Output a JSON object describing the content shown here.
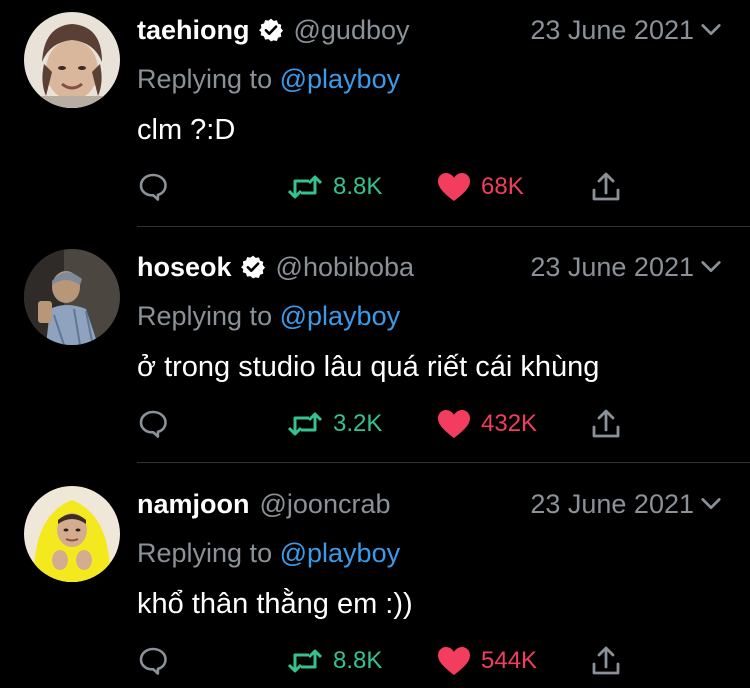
{
  "colors": {
    "background": "#000000",
    "primary_text": "#ffffff",
    "secondary_text": "#8b9198",
    "link": "#3a9bea",
    "retweet": "#35c28f",
    "like": "#f23d5e",
    "divider": "#2f3336"
  },
  "tweets": [
    {
      "display_name": "taehiong",
      "verified": true,
      "handle": "@gudboy",
      "date": "23 June 2021",
      "reply_prefix": "Replying to",
      "reply_to": "@playboy",
      "text": "clm ?:D",
      "retweets": "8.8K",
      "likes": "68K",
      "liked": true
    },
    {
      "display_name": "hoseok",
      "verified": true,
      "handle": "@hobiboba",
      "date": "23 June 2021",
      "reply_prefix": "Replying to",
      "reply_to": "@playboy",
      "text": "ở trong studio lâu quá riết cái khùng",
      "retweets": "3.2K",
      "likes": "432K",
      "liked": true
    },
    {
      "display_name": "namjoon",
      "verified": false,
      "handle": "@jooncrab",
      "date": "23 June 2021",
      "reply_prefix": "Replying to",
      "reply_to": "@playboy",
      "text": "khổ thân thằng em :))",
      "retweets": "8.8K",
      "likes": "544K",
      "liked": true
    }
  ],
  "icons": {
    "verified": "verified-badge-icon",
    "menu": "chevron-down-icon",
    "reply": "reply-icon",
    "retweet": "retweet-icon",
    "like": "heart-icon",
    "share": "share-icon"
  }
}
